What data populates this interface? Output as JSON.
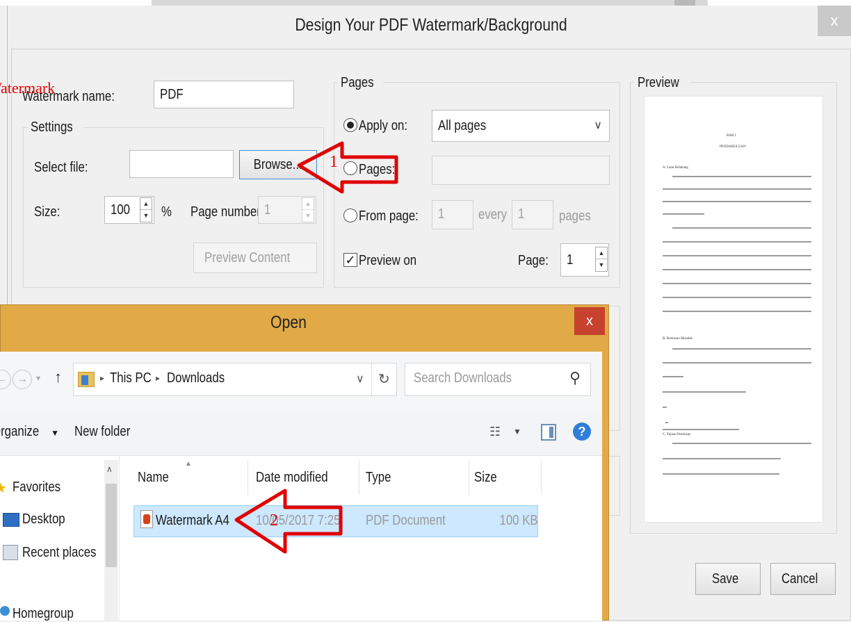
{
  "main_dialog": {
    "title": "Design Your PDF Watermark/Background",
    "close_glyph": "x",
    "watermark_name_label": "Watermark name:",
    "watermark_name_value": "PDF",
    "settings": {
      "group_title": "Settings",
      "select_file_label": "Select file:",
      "select_file_value": "",
      "browse_label": "Browse...",
      "size_label": "Size:",
      "size_value": "100",
      "size_unit": "%",
      "page_number_label": "Page number:",
      "page_number_value": "1",
      "preview_content_label": "Preview  Content"
    },
    "pages": {
      "group_title": "Pages",
      "apply_on_label": "Apply on:",
      "apply_on_value": "All pages",
      "pages_label": "Pages:",
      "pages_value": "",
      "from_page_label": "From page:",
      "from_page_value": "1",
      "every_label": "every",
      "every_value": "1",
      "pages_suffix": "pages",
      "preview_on_label": "Preview on",
      "page_label": "Page:",
      "page_value": "1"
    },
    "preview": {
      "group_title": "Preview",
      "doc_heading_1": "BAB I",
      "doc_heading_2": "PENDAHULUAN",
      "doc_section_a": "A. Latar Belakang",
      "doc_section_b": "B. Rumusan Masalah",
      "doc_section_c": "C. Tujuan Penulisan"
    },
    "save_label": "Save",
    "cancel_label": "Cancel"
  },
  "open_dialog": {
    "title": "Open",
    "close_glyph": "x",
    "breadcrumb": [
      "This PC",
      "Downloads"
    ],
    "search_placeholder": "Search Downloads",
    "organize_label": "Organize",
    "new_folder_label": "New folder",
    "columns": {
      "name": "Name",
      "date_modified": "Date modified",
      "type": "Type",
      "size": "Size"
    },
    "nav_items": [
      "Favorites",
      "Desktop",
      "Recent places",
      "Homegroup"
    ],
    "files": [
      {
        "name": "Watermark A4",
        "date_modified": "10/05/2017 7:25",
        "type": "PDF Document",
        "size": "100 KB"
      }
    ]
  },
  "annotations": {
    "watermark_label": "Watermark",
    "step_1": "1",
    "step_2": "2",
    "arrow_color": "#e00000"
  },
  "colors": {
    "open_dialog_frame": "#e1aa46",
    "open_close_button": "#c7412f",
    "selected_row": "#cde8ff"
  }
}
